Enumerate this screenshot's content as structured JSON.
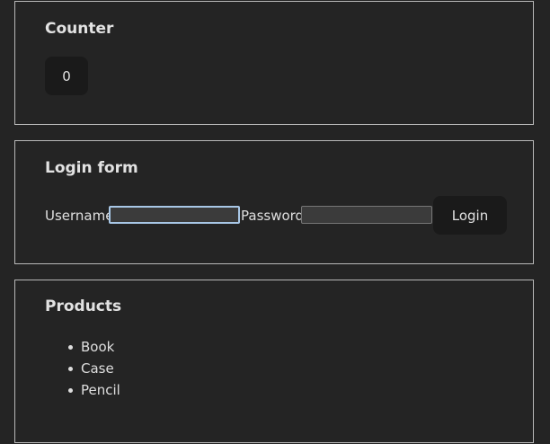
{
  "counter": {
    "title": "Counter",
    "value": "0"
  },
  "login": {
    "title": "Login form",
    "username_label": "Username",
    "username_value": "",
    "password_label": "Password",
    "password_value": "",
    "button_label": "Login"
  },
  "products": {
    "title": "Products",
    "items": [
      {
        "label": "Book"
      },
      {
        "label": "Case"
      },
      {
        "label": "Pencil"
      }
    ]
  }
}
